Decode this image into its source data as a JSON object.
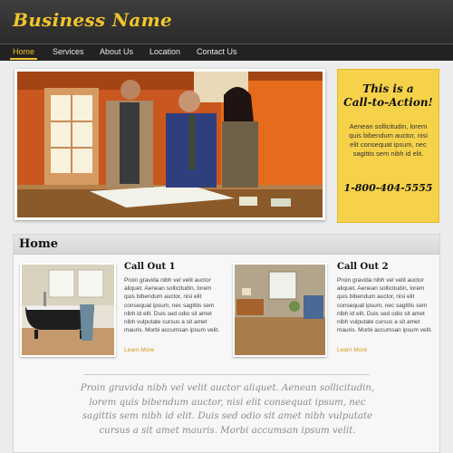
{
  "header": {
    "brand": "Business Name"
  },
  "nav": {
    "items": [
      {
        "label": "Home",
        "active": true
      },
      {
        "label": "Services",
        "active": false
      },
      {
        "label": "About Us",
        "active": false
      },
      {
        "label": "Location",
        "active": false
      },
      {
        "label": "Contact Us",
        "active": false
      }
    ]
  },
  "cta": {
    "title_line1": "This is a",
    "title_line2": "Call-to-Action!",
    "text": "Aenean sollicitudin, lorem quis bibendum auctor, nisi elit consequat ipsum, nec sagittis sem nibh id elit.",
    "phone": "1-800-404-5555"
  },
  "main": {
    "title": "Home",
    "callouts": [
      {
        "title": "Call Out 1",
        "text": "Proin gravida nibh vel velit auctor aliquet. Aenean sollicitudin, lorem quis bibendum auctor, nisi elit consequat ipsum, nec sagittis sem nibh id elit. Duis sed odio sit amet nibh vulputate cursus a sit amet mauris. Morbi accumsan ipsum velit.",
        "link": "Learn More"
      },
      {
        "title": "Call Out 2",
        "text": "Proin gravida nibh vel velit auctor aliquet. Aenean sollicitudin, lorem quis bibendum auctor, nisi elit consequat ipsum, nec sagittis sem nibh id elit. Duis sed odio sit amet nibh vulputate cursus a sit amet mauris. Morbi accumsan ipsum velit.",
        "link": "Learn More"
      }
    ],
    "quote": "Proin gravida nibh vel velit auctor aliquet. Aenean sollicitudin, lorem quis bibendum auctor, nisi elit consequat ipsum, nec sagittis sem nibh id elit. Duis sed odio sit amet nibh vulputate cursus a sit amet mauris. Morbi accumsan ipsum velit."
  },
  "colors": {
    "accent": "#f2c52a",
    "header_bg": "#2e2e2e",
    "cta_bg": "#f6d24a",
    "link": "#d49a18"
  }
}
